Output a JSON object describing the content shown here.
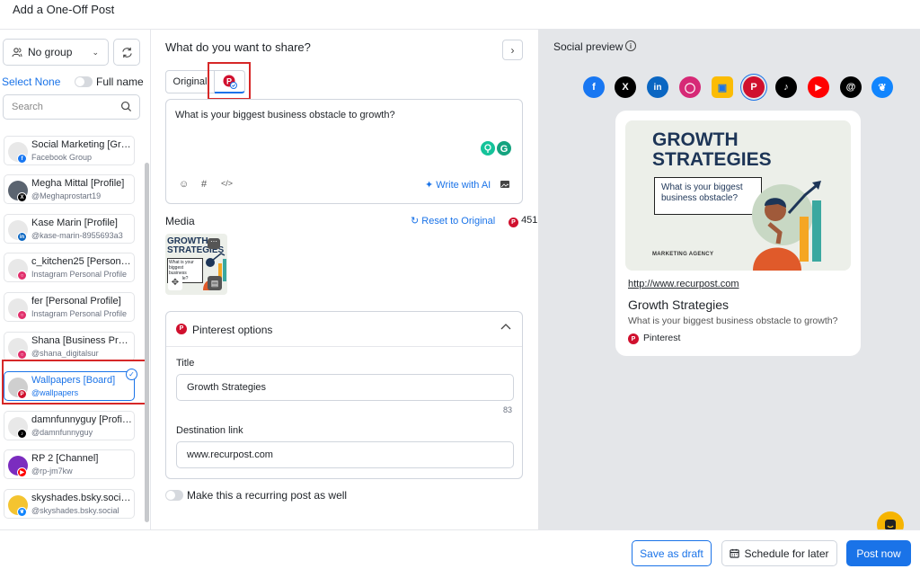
{
  "header": {
    "title": "Add a One-Off Post"
  },
  "sidebar": {
    "group_select": "No group",
    "select_none": "Select None",
    "full_name": "Full name",
    "search_placeholder": "Search",
    "accounts": [
      {
        "name": "Social Marketing [Gro...",
        "sub": "Facebook Group",
        "network": "facebook"
      },
      {
        "name": "Megha Mittal [Profile]",
        "sub": "@Meghaprostart19",
        "network": "x"
      },
      {
        "name": "Kase Marin [Profile]",
        "sub": "@kase-marin-8955693a3",
        "network": "linkedin"
      },
      {
        "name": "c_kitchen25 [Personal ...",
        "sub": "Instagram Personal Profile",
        "network": "instagram"
      },
      {
        "name": "fer [Personal Profile]",
        "sub": "Instagram Personal Profile",
        "network": "instagram"
      },
      {
        "name": "Shana [Business Profile]",
        "sub": "@shana_digitalsur",
        "network": "instagram"
      },
      {
        "name": "Wallpapers [Board]",
        "sub": "@wallpapers",
        "network": "pinterest",
        "selected": true
      },
      {
        "name": "damnfunnyguy [Profile]",
        "sub": "@damnfunnyguy",
        "network": "tiktok"
      },
      {
        "name": "RP 2 [Channel]",
        "sub": "@rp-jm7kw",
        "network": "youtube"
      },
      {
        "name": "skyshades.bsky.social...",
        "sub": "@skyshades.bsky.social",
        "network": "bluesky"
      }
    ]
  },
  "composer": {
    "question": "What do you want to share?",
    "tab_original": "Original",
    "post_text": "What is your biggest business obstacle to growth?",
    "write_ai": "Write with AI",
    "media_label": "Media",
    "reset_label": "Reset to Original",
    "char_count": "451",
    "thumb_headline": "GROWTH STRATEGIES",
    "thumb_bubble": "What is your biggest business obstacle?",
    "pinterest_options": {
      "label": "Pinterest options",
      "title_label": "Title",
      "title_value": "Growth Strategies",
      "title_count": "83",
      "link_label": "Destination link",
      "link_value": "www.recurpost.com"
    },
    "recurring_label": "Make this a recurring post as well"
  },
  "preview": {
    "title": "Social preview",
    "networks": [
      "facebook",
      "x",
      "linkedin",
      "instagram",
      "google-business",
      "pinterest",
      "tiktok",
      "youtube",
      "threads",
      "bluesky"
    ],
    "selected_network": "pinterest",
    "card": {
      "headline": "GROWTH STRATEGIES",
      "bubble": "What is your biggest business obstacle?",
      "agency": "MARKETING AGENCY",
      "url": "http://www.recurpost.com",
      "title": "Growth Strategies",
      "description": "What is your biggest business obstacle to growth?",
      "source": "Pinterest"
    }
  },
  "footer": {
    "save_draft": "Save as draft",
    "schedule": "Schedule for later",
    "post_now": "Post now"
  },
  "colors": {
    "accent": "#1a73e8",
    "highlight": "#d62828",
    "pinterest": "#d0102e",
    "chat": "#f6b400"
  }
}
